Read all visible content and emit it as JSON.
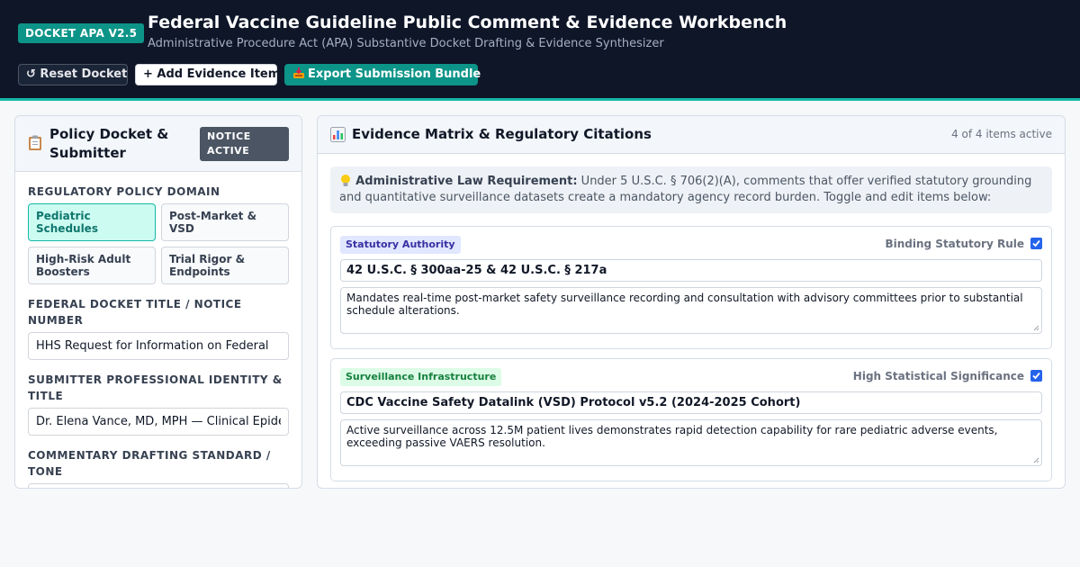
{
  "header": {
    "badge": "DOCKET APA V2.5",
    "title": "Federal Vaccine Guideline Public Comment & Evidence Workbench",
    "subtitle": "Administrative Procedure Act (APA) Substantive Docket Drafting & Evidence Synthesizer",
    "buttons": {
      "reset": "↺ Reset Docket",
      "add": "+ Add Evidence Item",
      "export": "Export Submission Bundle"
    }
  },
  "left": {
    "title": "Policy Docket & Submitter",
    "notice_badge": "NOTICE ACTIVE",
    "domain_label": "REGULATORY POLICY DOMAIN",
    "domains": [
      {
        "label": "Pediatric Schedules",
        "active": true
      },
      {
        "label": "Post-Market & VSD",
        "active": false
      },
      {
        "label": "High-Risk Adult Boosters",
        "active": false
      },
      {
        "label": "Trial Rigor & Endpoints",
        "active": false
      }
    ],
    "docket_label": "FEDERAL DOCKET TITLE / NOTICE NUMBER",
    "docket_value": "HHS Request for Information on Federal",
    "submitter_label": "SUBMITTER PROFESSIONAL IDENTITY & TITLE",
    "submitter_value": "Dr. Elena Vance, MD, MPH — Clinical Epidemiologist",
    "tone_label": "COMMENTARY DRAFTING STANDARD / TONE"
  },
  "right": {
    "title": "Evidence Matrix & Regulatory Citations",
    "count": "4 of 4 items active",
    "note_bold": "Administrative Law Requirement:",
    "note_text": " Under 5 U.S.C. § 706(2)(A), comments that offer verified statutory grounding and quantitative surveillance datasets create a mandatory agency record burden. Toggle and edit items below:",
    "items": [
      {
        "tag": "Statutory Authority",
        "flag": "Binding Statutory Rule",
        "checked": true,
        "citation": "42 U.S.C. § 300aa-25 & 42 U.S.C. § 217a",
        "description": "Mandates real-time post-market safety surveillance recording and consultation with advisory committees prior to substantial schedule alterations."
      },
      {
        "tag": "Surveillance Infrastructure",
        "flag": "High Statistical Significance",
        "checked": true,
        "citation": "CDC Vaccine Safety Datalink (VSD) Protocol v5.2 (2024-2025 Cohort)",
        "description": "Active surveillance across 12.5M patient lives demonstrates rapid detection capability for rare pediatric adverse events, exceeding passive VAERS resolution."
      }
    ]
  },
  "icons": {
    "clipboard": "clipboard-icon",
    "chart": "bar-chart-icon",
    "bulb": "lightbulb-icon",
    "inbox": "inbox-tray-icon"
  }
}
